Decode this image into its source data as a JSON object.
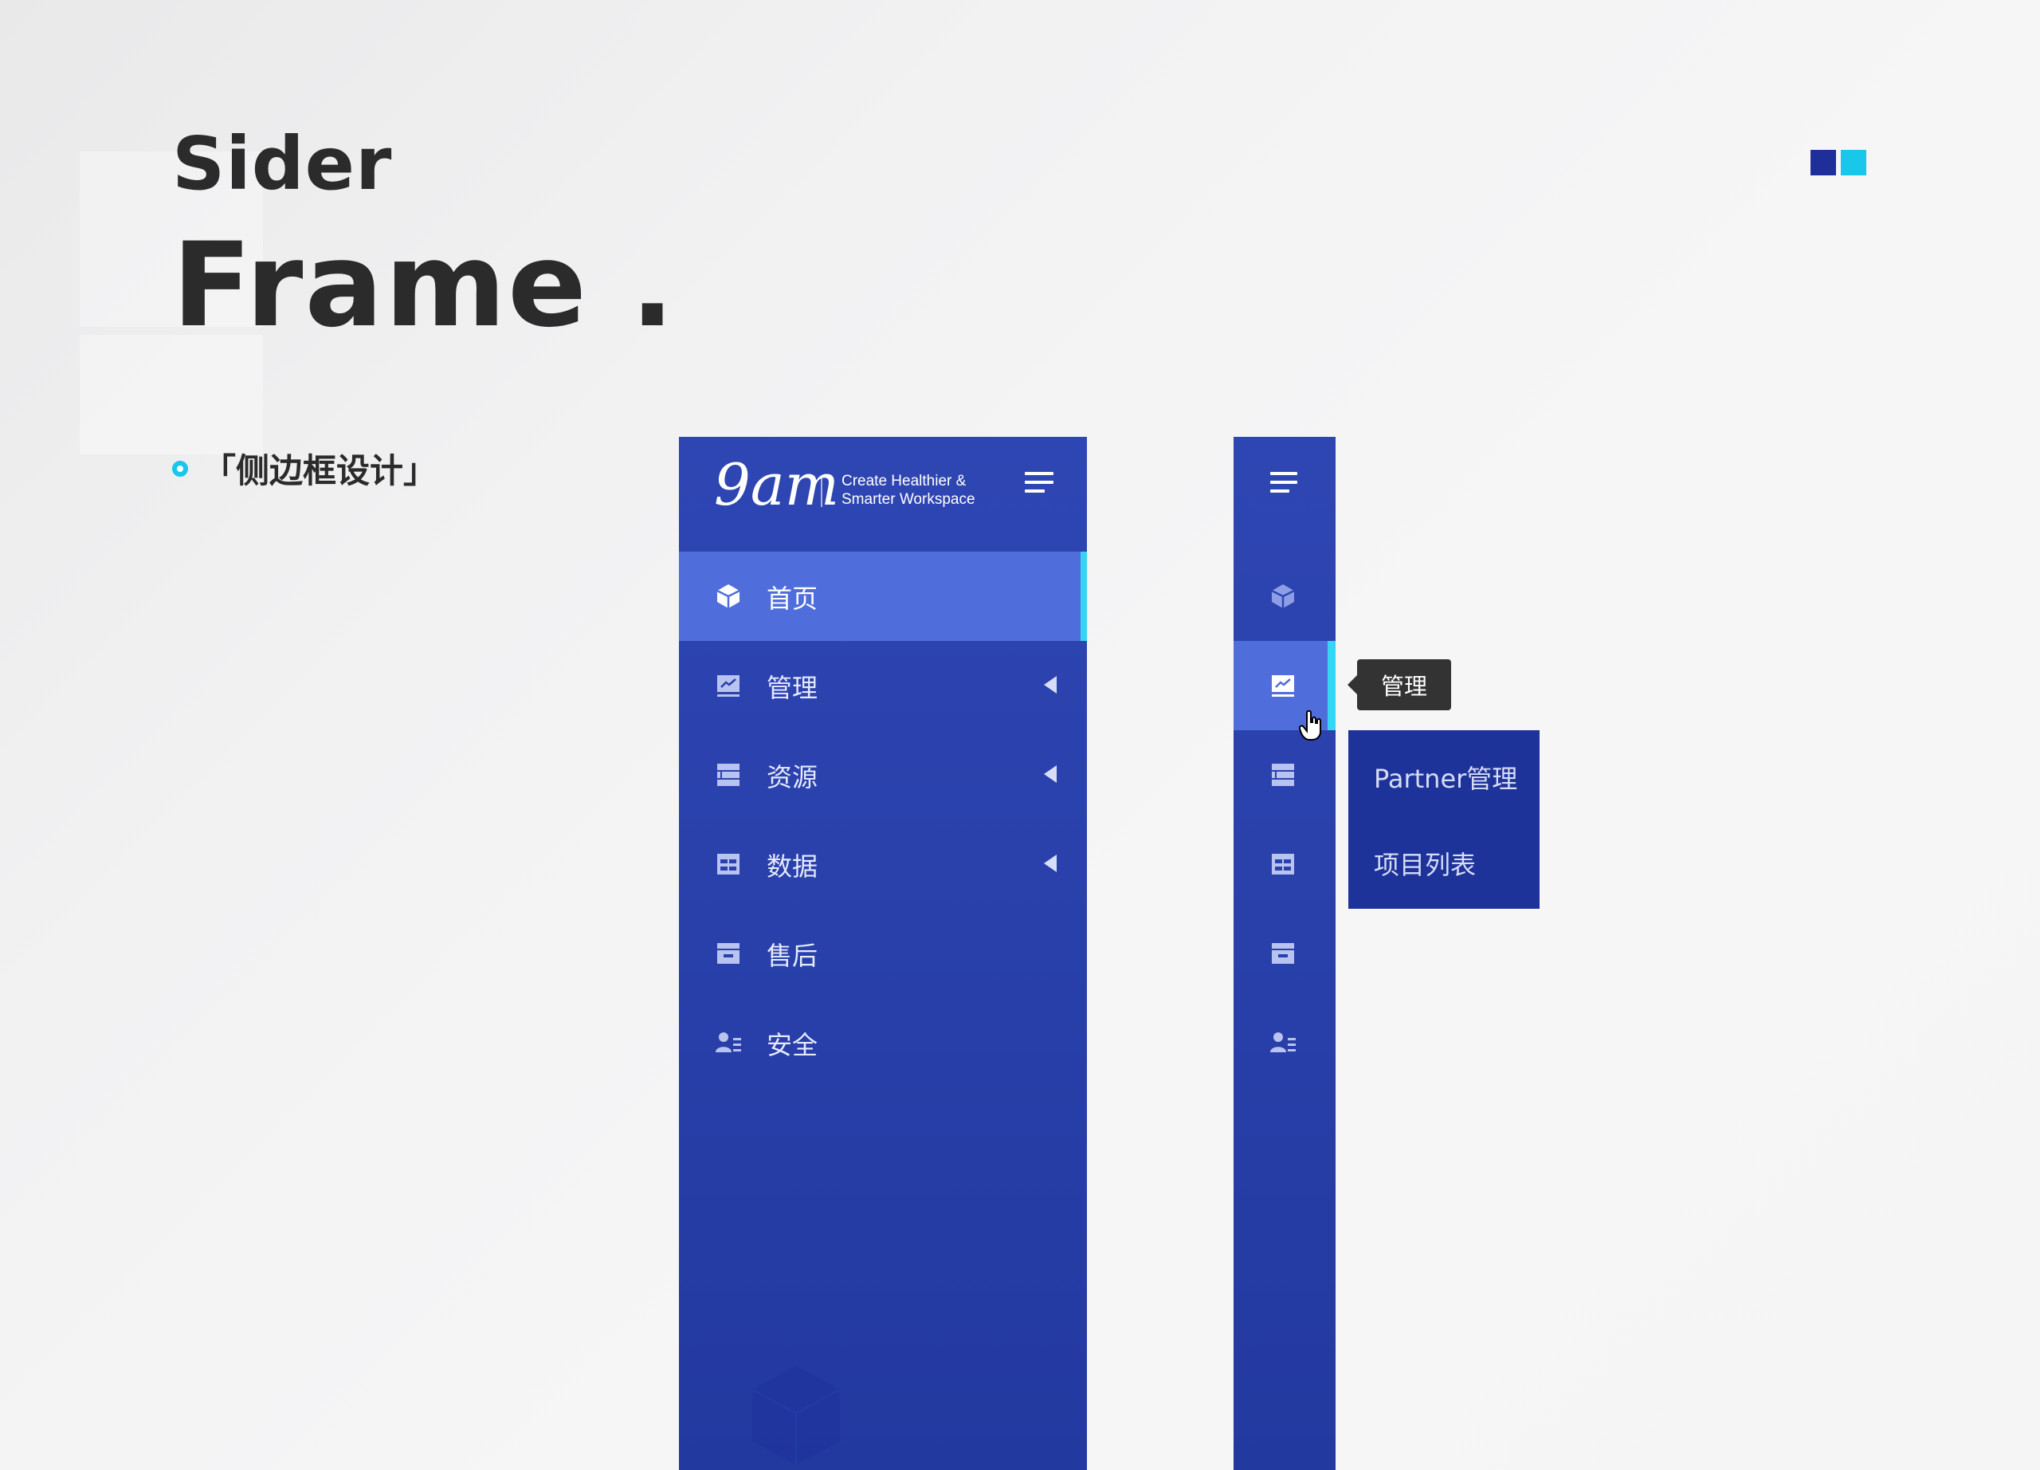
{
  "header": {
    "subtitle": "Sider",
    "title": "Frame .",
    "section_label": "「侧边框设计」"
  },
  "brand_colors": {
    "navy": "#1f2f99",
    "cyan": "#18c7ea"
  },
  "sider": {
    "logo_text": "9am",
    "tagline_line1": "Create Healthier &",
    "tagline_line2": "Smarter Workspace",
    "toggle_icon": "hamburger-menu-icon",
    "items": [
      {
        "label": "首页",
        "icon": "cube-icon",
        "active": true,
        "has_submenu": false
      },
      {
        "label": "管理",
        "icon": "chart-monitor-icon",
        "active": false,
        "has_submenu": true
      },
      {
        "label": "资源",
        "icon": "stack-icon",
        "active": false,
        "has_submenu": true
      },
      {
        "label": "数据",
        "icon": "table-icon",
        "active": false,
        "has_submenu": true
      },
      {
        "label": "售后",
        "icon": "archive-box-icon",
        "active": false,
        "has_submenu": false
      },
      {
        "label": "安全",
        "icon": "user-list-icon",
        "active": false,
        "has_submenu": false
      }
    ]
  },
  "collapsed_sider": {
    "active_index": 1,
    "tooltip": "管理",
    "submenu": [
      "Partner管理",
      "项目列表"
    ]
  }
}
